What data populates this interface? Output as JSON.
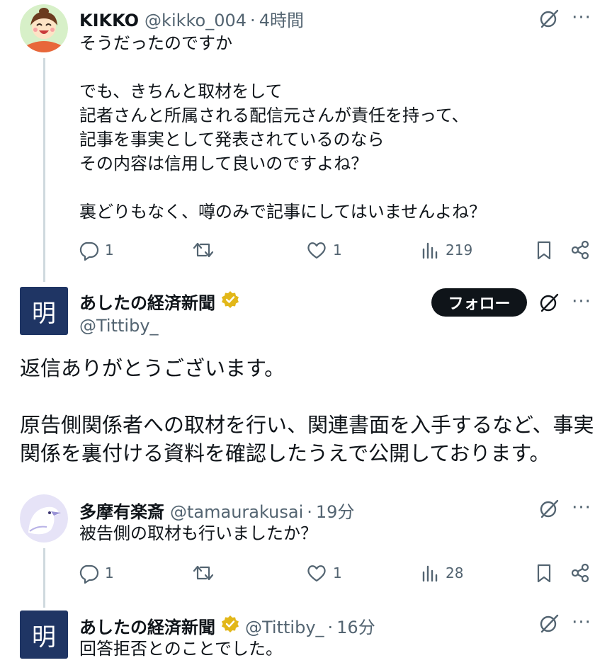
{
  "posts": [
    {
      "name": "KIKKO",
      "handle": "@kikko_004",
      "time": "4時間",
      "text": "そうだったのですか\n\nでも、きちんと取材をして\n記者さんと所属される配信元さんが責任を持って、\n記事を事実として発表されているのなら\nその内容は信用して良いのですよね？\n\n裏どりもなく、噂のみで記事にしてはいませんよね？",
      "replies": "1",
      "likes": "1",
      "views": "219"
    },
    {
      "name": "あしたの経済新聞",
      "handle": "@Tittiby_",
      "avatar_glyph": "明",
      "follow_label": "フォロー",
      "text": "返信ありがとうございます。\n\n原告側関係者への取材を行い、関連書面を入手するなど、事実\n関係を裏付ける資料を確認したうえで公開しております。"
    },
    {
      "name": "多摩有楽斎",
      "handle": "@tamaurakusai",
      "time": "19分",
      "text": "被告側の取材も行いましたか？",
      "replies": "1",
      "likes": "1",
      "views": "28"
    },
    {
      "name": "あしたの経済新聞",
      "handle": "@Tittiby_",
      "time": "16分",
      "avatar_glyph": "明",
      "text": "回答拒否とのことでした。"
    }
  ],
  "separator": "·",
  "more_glyph": "···",
  "colors": {
    "text": "#0f1419",
    "secondary": "#536471",
    "verified_gold": "#e2b719",
    "avatar_navy": "#1f3564",
    "thread_line": "#cfd9de"
  },
  "icons": [
    "grok-icon",
    "more-icon",
    "reply-icon",
    "retweet-icon",
    "like-icon",
    "views-icon",
    "bookmark-icon",
    "share-icon",
    "verified-badge-icon"
  ]
}
